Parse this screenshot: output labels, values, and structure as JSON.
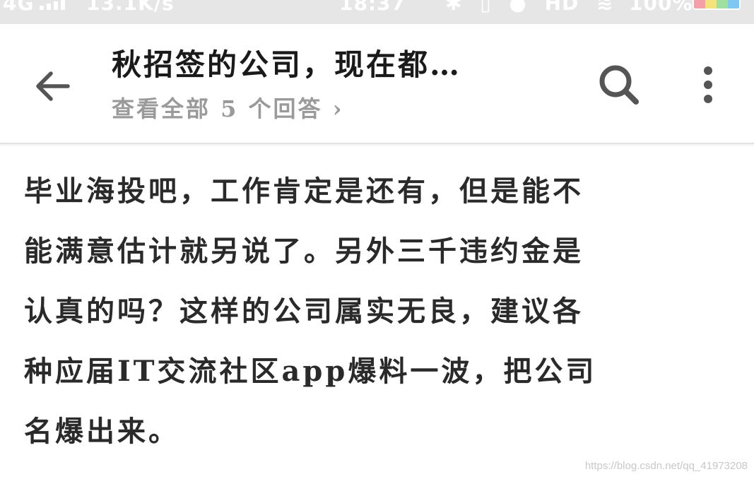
{
  "status_bar": {
    "network": "4G",
    "speed": "13.1K/s",
    "time": "18:37",
    "battery_percent": "100%",
    "battery_colors": [
      "#f4a0a8",
      "#f6e27a",
      "#9fe0a0",
      "#7fc8f4"
    ]
  },
  "app_bar": {
    "back_icon": "arrow-left-icon",
    "title": "秋招签的公司，现在都…",
    "view_all": "查看全部 5 个回答 ›",
    "search_icon": "search-icon",
    "more_icon": "more-vertical-icon"
  },
  "answer": {
    "lines": [
      "毕业海投吧，工作肯定是还有，但是能不",
      "能满意估计就另说了。另外三千违约金是",
      "认真的吗？这样的公司属实无良，建议各",
      "种应届IT交流社区app爆料一波，把公司",
      "名爆出来。"
    ]
  },
  "watermark": "https://blog.csdn.net/qq_41973208",
  "colors": {
    "title": "#1a1a1a",
    "subtitle": "#9a9a9a",
    "body_text": "#2a2a2a",
    "icon": "#555555",
    "status_bar_bg": "#e6e6e6"
  }
}
